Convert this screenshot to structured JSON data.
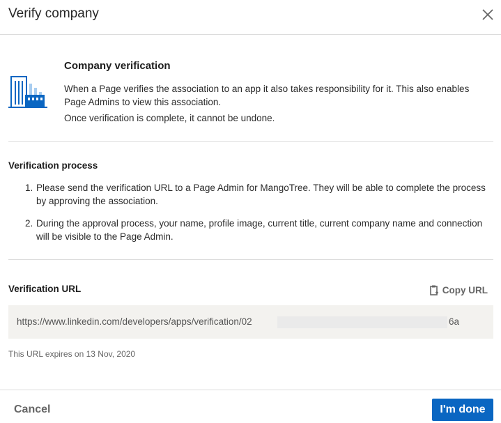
{
  "dialog": {
    "title": "Verify company"
  },
  "intro": {
    "heading": "Company verification",
    "paragraph1": "When a Page verifies the association to an app it also takes responsibility for it. This also enables Page Admins to view this association.",
    "paragraph2": "Once verification is complete, it cannot be undone.",
    "icon": "building-icon"
  },
  "process": {
    "heading": "Verification process",
    "steps": [
      {
        "number": "1.",
        "text": "Please send the verification URL to a Page Admin for MangoTree. They will be able to complete the process by approving the association."
      },
      {
        "number": "2.",
        "text": "During the approval process, your name, profile image, current title, current company name and connection will be visible to the Page Admin."
      }
    ]
  },
  "verification_url": {
    "heading": "Verification URL",
    "copy_label": "Copy URL",
    "url_visible_start": "https://www.linkedin.com/developers/apps/verification/02",
    "url_visible_end": "6a",
    "expiry_text": "This URL expires on 13 Nov, 2020"
  },
  "footer": {
    "cancel_label": "Cancel",
    "done_label": "I'm done"
  },
  "colors": {
    "primary": "#0a66c2",
    "icon_blue": "#0a66c2",
    "icon_light": "#a8cdf0",
    "url_bg": "#f3f2ef"
  }
}
